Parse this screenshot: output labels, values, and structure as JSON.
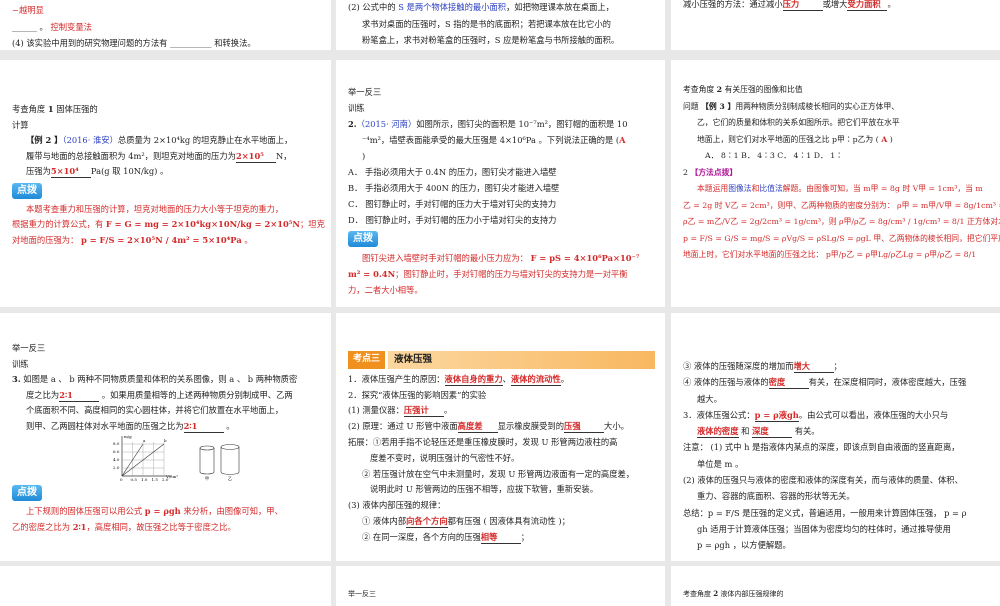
{
  "slides": [
    {
      "id": "s1",
      "lines": [
        {
          "segs": [
            {
              "t": "−越明显",
              "s": "red"
            }
          ]
        },
        {
          "segs": [
            {
              "t": "______ 。"
            },
            {
              "t": "                                    控制变量法",
              "s": "red"
            }
          ]
        },
        {
          "segs": [
            {
              "t": "(4) 该实验中用到的研究物理问题的方法有 __________ 和转换法。"
            }
          ]
        }
      ]
    },
    {
      "id": "s2",
      "lines": [
        {
          "segs": [
            {
              "t": "(2) 公式中的 "
            },
            {
              "t": "S 是两个物体接触的最小面积",
              "s": "blue"
            },
            {
              "t": "，如把物理课本放在桌面上，"
            }
          ]
        },
        {
          "cls": "ind",
          "segs": [
            {
              "t": "求书对桌面的压强时，S 指的是书的底面积；若把课本放在比它小的"
            }
          ]
        },
        {
          "cls": "ind",
          "segs": [
            {
              "t": "粉笔盒上，求书对粉笔盒的压强时，S 应是粉笔盒与书所接触的面积。"
            }
          ]
        }
      ]
    },
    {
      "id": "s3",
      "lines": [
        {
          "segs": [
            {
              "t": "减小压强的方法：通过减小"
            },
            {
              "t": "压力",
              "s": "ans"
            },
            {
              "t": "或增大"
            },
            {
              "t": "受力面积",
              "s": "ans"
            },
            {
              "t": "。"
            }
          ]
        }
      ]
    },
    {
      "id": "s4",
      "lines": [
        {
          "segs": [
            {
              "t": "   考查角度 "
            },
            {
              "t": "1",
              "s": "bold"
            },
            {
              "t": "     固体压强的"
            }
          ]
        },
        {
          "segs": [
            {
              "t": "计算"
            }
          ]
        },
        {
          "cls": "ind",
          "segs": [
            {
              "t": "【例 2 】",
              "s": "bold"
            },
            {
              "t": "（2016· 淮安）",
              "s": "blue"
            },
            {
              "t": "总质量为 2×10⁴kg 的坦克静止在水平地面上，"
            }
          ]
        },
        {
          "cls": "ind",
          "segs": [
            {
              "t": "履带与地面的总接触面积为 4m²，则坦克对地面的压力为"
            },
            {
              "t": "2×10⁵",
              "s": "ans"
            },
            {
              "t": "N，"
            }
          ]
        },
        {
          "cls": "ind",
          "segs": [
            {
              "t": "压强为"
            },
            {
              "t": "5×10⁴",
              "s": "ans"
            },
            {
              "t": "Pa(g 取 10N/kg) 。"
            }
          ]
        },
        {
          "tip": "点拨"
        },
        {
          "cls": "ind red",
          "segs": [
            {
              "t": "本题考查重力和压强的计算，坦克对地面的压力大小等于坦克的重力，"
            }
          ]
        },
        {
          "cls": "red",
          "segs": [
            {
              "t": "根据重力的计算公式，有 "
            },
            {
              "t": "F = G = mg = 2×10⁴kg×10N/kg = 2×10⁵N",
              "s": "bold"
            },
            {
              "t": "；坦克"
            }
          ]
        },
        {
          "cls": "red",
          "segs": [
            {
              "t": "对地面的压强为： "
            },
            {
              "t": "p = F/S = 2×10⁵N / 4m² = 5×10⁴Pa",
              "s": "bold"
            },
            {
              "t": " 。"
            }
          ]
        }
      ]
    },
    {
      "id": "s5",
      "lines": [
        {
          "segs": [
            {
              "t": "   举一反三"
            }
          ]
        },
        {
          "segs": [
            {
              "t": "训练"
            }
          ]
        },
        {
          "segs": [
            {
              "t": "2.",
              "s": "bold"
            },
            {
              "t": "（2015· 河南）",
              "s": "blue"
            },
            {
              "t": "如图所示，图钉尖的面积是 10⁻⁷m²，图钉帽的面积是 10"
            }
          ]
        },
        {
          "cls": "ind",
          "segs": [
            {
              "t": "⁻⁴m²，墙壁表面能承受的最大压强是 4×10⁶Pa 。下列说法正确的是 ("
            },
            {
              "t": "A",
              "s": "red bold"
            }
          ]
        },
        {
          "cls": "ind",
          "segs": [
            {
              "t": ")"
            }
          ]
        },
        {
          "segs": [
            {
              "t": "A． 手指必须用大于 0.4N 的压力，图钉尖才能进入墙壁"
            }
          ]
        },
        {
          "segs": [
            {
              "t": "B． 手指必须用大于 400N 的压力，图钉尖才能进入墙壁"
            }
          ]
        },
        {
          "segs": [
            {
              "t": "C． 图钉静止时，手对钉帽的压力大于墙对钉尖的支持力"
            }
          ]
        },
        {
          "segs": [
            {
              "t": "D． 图钉静止时，手对钉帽的压力小于墙对钉尖的支持力"
            }
          ]
        },
        {
          "tip": "点拨"
        },
        {
          "cls": "ind red",
          "segs": [
            {
              "t": "图钉尖进入墙壁时手对钉帽的最小压力应为： "
            },
            {
              "t": "F = pS = 4×10⁶Pa×10⁻⁷",
              "s": "bold"
            }
          ]
        },
        {
          "cls": "red",
          "segs": [
            {
              "t": "m² = 0.4N",
              "s": "bold"
            },
            {
              "t": "；图钉静止时，手对钉帽的压力与墙对钉尖的支持力是一对平衡"
            }
          ]
        },
        {
          "cls": "red",
          "segs": [
            {
              "t": "力，二者大小相等。"
            }
          ]
        }
      ]
    },
    {
      "id": "s6",
      "lines": [
        {
          "segs": [
            {
              "t": "   考查角度 "
            },
            {
              "t": "2",
              "s": "bold"
            },
            {
              "t": "    有关压强的图像和比值"
            }
          ]
        },
        {
          "segs": [
            {
              "t": "问题  "
            },
            {
              "t": "【例 3 】",
              "s": "bold"
            },
            {
              "t": "用两种物质分别制成棱长相同的实心正方体甲、"
            }
          ]
        },
        {
          "cls": "ind",
          "segs": [
            {
              "t": "乙，它们的质量和体积的关系如图所示。把它们平放在水平"
            }
          ]
        },
        {
          "cls": "ind",
          "segs": [
            {
              "t": "地面上，则它们对水平地面的压强之比 p甲∶p乙为 (  "
            },
            {
              "t": "A",
              "s": "red bold"
            },
            {
              "t": "  )"
            }
          ]
        },
        {
          "cls": "ind2",
          "segs": [
            {
              "t": "A． 8∶1     B． 4∶3     C． 4∶1     D． 1∶"
            }
          ]
        },
        {
          "segs": [
            {
              "t": "2 "
            },
            {
              "t": "【方法点拨】",
              "s": "purple"
            }
          ]
        },
        {
          "cls": "ind red",
          "segs": [
            {
              "t": "本题运用"
            },
            {
              "t": "图像法",
              "s": "blue"
            },
            {
              "t": "和"
            },
            {
              "t": "比值法",
              "s": "blue"
            },
            {
              "t": "解题。由图像可知，当 m甲 = 8g 时 V甲 = 1cm³，当 m"
            }
          ]
        },
        {
          "cls": "red",
          "segs": [
            {
              "t": "乙 = 2g 时 V乙 = 2cm³，则甲、乙两种物质的密度分别为： ρ甲 = m甲/V甲 = 8g/1cm³ = 8g/cm³ ，"
            }
          ]
        },
        {
          "cls": "red",
          "segs": [
            {
              "t": "ρ乙 = m乙/V乙 = 2g/2cm³ = 1g/cm³，则  ρ甲/ρ乙 = 8g/cm³ / 1g/cm³ = 8/1  正方体对水平地面的压强："
            }
          ]
        },
        {
          "cls": "red",
          "segs": [
            {
              "t": "p = F/S = G/S = mg/S = ρVg/S = ρSLg/S = ρgL  甲、乙两物体的棱长相同，把它们平放在水平"
            }
          ]
        },
        {
          "cls": "red",
          "segs": [
            {
              "t": "地面上时，它们对水平地面的压强之比： p甲/p乙 = ρ甲Lg/ρ乙Lg = ρ甲/ρ乙 = 8/1"
            }
          ]
        }
      ]
    },
    {
      "id": "s7",
      "lines": [
        {
          "segs": [
            {
              "t": "   举一反三"
            }
          ]
        },
        {
          "segs": [
            {
              "t": "训练"
            }
          ]
        },
        {
          "segs": [
            {
              "t": "3.",
              "s": "bold"
            },
            {
              "t": " 如图是 a 、 b 两种不同物质质量和体积的关系图像，则 a 、 b 两种物质密"
            }
          ]
        },
        {
          "cls": "ind",
          "segs": [
            {
              "t": "度之比为"
            },
            {
              "t": "2∶1",
              "s": "ans"
            },
            {
              "t": " 。如果用质量相等的上述两种物质分别制成甲、乙两"
            }
          ]
        },
        {
          "cls": "ind",
          "segs": [
            {
              "t": "个底面积不同、高度相同的实心圆柱体，并将它们放置在水平地面上，"
            }
          ]
        },
        {
          "cls": "ind",
          "segs": [
            {
              "t": "则甲、乙两圆柱体对水平地面的压强之比为"
            },
            {
              "t": "2∶1",
              "s": "ans"
            },
            {
              "t": " 。"
            }
          ]
        },
        {
          "fig": "graph"
        },
        {
          "tip": "点拨"
        },
        {
          "cls": "ind red",
          "segs": [
            {
              "t": "上下规则的固体压强可以用公式 "
            },
            {
              "t": "p = ρgh",
              "s": "bold"
            },
            {
              "t": " 来分析，由图像可知，甲、"
            }
          ]
        },
        {
          "cls": "red",
          "segs": [
            {
              "t": "乙的密度之比为 "
            },
            {
              "t": "2∶1",
              "s": "bold"
            },
            {
              "t": "，高度相同，故压强之比等于密度之比。"
            }
          ]
        }
      ],
      "graph": {
        "ylabel": "m/g",
        "xlabel": "V/cm³",
        "yticks": [
          "8.0",
          "6.0",
          "4.0",
          "2.0"
        ],
        "xticks": [
          "0",
          "0.5",
          "1.0",
          "1.5",
          "2.0"
        ],
        "lines": [
          "a",
          "b"
        ],
        "cyl": [
          "甲",
          "乙"
        ]
      }
    },
    {
      "id": "s8",
      "kd": {
        "tag": "考点三",
        "title": "液体压强"
      },
      "lines": [
        {
          "segs": [
            {
              "t": "1．液体压强产生的原因："
            },
            {
              "t": "液体自身的重力",
              "s": "ans"
            },
            {
              "t": "、"
            },
            {
              "t": "液体的流动性",
              "s": "ans"
            },
            {
              "t": "。"
            }
          ]
        },
        {
          "segs": [
            {
              "t": "2．探究“液体压强的影响因素”的实验"
            }
          ]
        },
        {
          "segs": [
            {
              "t": "(1) 测量仪器："
            },
            {
              "t": "压强计",
              "s": "ans"
            },
            {
              "t": "。"
            }
          ]
        },
        {
          "segs": [
            {
              "t": "(2) 原理：通过 U 形管中液面"
            },
            {
              "t": "高度差",
              "s": "ans"
            },
            {
              "t": "显示橡皮膜受到的"
            },
            {
              "t": "压强",
              "s": "ans"
            },
            {
              "t": "大小。"
            }
          ]
        },
        {
          "segs": [
            {
              "t": "拓展：①若用手指不论轻压还是重压橡皮膜时，发现 U 形管两边液柱的高"
            }
          ]
        },
        {
          "cls": "ind2",
          "segs": [
            {
              "t": "度差不变时，说明压强计的气密性不好。"
            }
          ]
        },
        {
          "cls": "ind",
          "segs": [
            {
              "t": "② 若压强计放在空气中未测量时，发现 U 形管两边液面有一定的高度差，"
            }
          ]
        },
        {
          "cls": "ind2",
          "segs": [
            {
              "t": "说明此时 U 形管两边的压强不相等，应拔下软管，重新安装。"
            }
          ]
        },
        {
          "segs": [
            {
              "t": "(3) 液体内部压强的规律："
            }
          ]
        },
        {
          "cls": "ind",
          "segs": [
            {
              "t": "① 液体内部"
            },
            {
              "t": "向各个方向",
              "s": "ans"
            },
            {
              "t": "都有压强 ( 因液体具有流动性 )；"
            }
          ]
        },
        {
          "cls": "ind",
          "segs": [
            {
              "t": "② 在同一深度，各个方向的压强"
            },
            {
              "t": "相等",
              "s": "ans"
            },
            {
              "t": "；"
            }
          ]
        }
      ]
    },
    {
      "id": "s9",
      "lines": [
        {
          "segs": [
            {
              "t": " ③ 液体的压强随深度的增加而"
            },
            {
              "t": "增大",
              "s": "ans"
            },
            {
              "t": "；"
            }
          ]
        },
        {
          "segs": [
            {
              "t": "④ 液体的压强与液体的"
            },
            {
              "t": "密度",
              "s": "ans"
            },
            {
              "t": "有关，在深度相同时，液体密度越大，压强"
            }
          ]
        },
        {
          "cls": "ind",
          "segs": [
            {
              "t": "越大。"
            }
          ]
        },
        {
          "segs": [
            {
              "t": "3．液体压强公式："
            },
            {
              "t": "p = ρ液gh",
              "s": "ans"
            },
            {
              "t": "。由公式可以看出，液体压强的大小只与"
            }
          ]
        },
        {
          "cls": "ind",
          "segs": [
            {
              "t": "液体的密度",
              "s": "ans"
            },
            {
              "t": " 和 "
            },
            {
              "t": "深度",
              "s": "ans"
            },
            {
              "t": " 有关。"
            }
          ]
        },
        {
          "segs": [
            {
              "t": "注意： (1) 式中 h 是指液体内某点的深度，即该点到自由液面的竖直距离，"
            }
          ]
        },
        {
          "cls": "ind",
          "segs": [
            {
              "t": "单位是 m 。"
            }
          ]
        },
        {
          "segs": [
            {
              "t": "(2) 液体的压强只与液体的密度和液体的深度有关，而与液体的质量、体积、"
            }
          ]
        },
        {
          "cls": "ind",
          "segs": [
            {
              "t": "重力、容器的底面积、容器的形状等无关。"
            }
          ]
        },
        {
          "segs": [
            {
              "t": "总结：p = F/S  是压强的定义式，普遍适用，一般用来计算固体压强， p = ρ"
            }
          ]
        },
        {
          "cls": "ind",
          "segs": [
            {
              "t": "gh 适用于计算液体压强；当固体为密度均匀的柱体时，通过推导使用"
            }
          ]
        },
        {
          "cls": "ind",
          "segs": [
            {
              "t": "p = ρgh ，以方便解题。"
            }
          ]
        }
      ]
    },
    {
      "id": "s10",
      "lines": []
    },
    {
      "id": "s11",
      "lines": [
        {
          "segs": [
            {
              "t": "   举一反三"
            }
          ]
        }
      ]
    },
    {
      "id": "s12",
      "lines": [
        {
          "segs": [
            {
              "t": "   考查角度 "
            },
            {
              "t": "2",
              "s": "bold"
            },
            {
              "t": "    液体内部压强规律的"
            }
          ]
        }
      ]
    }
  ]
}
